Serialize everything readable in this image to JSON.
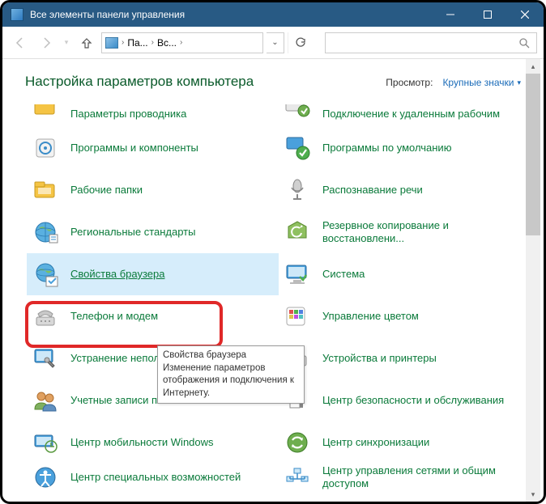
{
  "window": {
    "title": "Все элементы панели управления"
  },
  "toolbar": {
    "breadcrumb": [
      "Па...",
      "Вс..."
    ]
  },
  "header": {
    "title": "Настройка параметров компьютера",
    "view_label": "Просмотр:",
    "view_value": "Крупные значки"
  },
  "tooltip": {
    "title": "Свойства браузера",
    "body": "Изменение параметров отображения и подключения к Интернету."
  },
  "items": [
    {
      "label": "Параметры проводника",
      "icon": "folder-options",
      "cut": true
    },
    {
      "label": "Подключение к удаленным рабочим",
      "icon": "remote-app",
      "cut": true
    },
    {
      "label": "Программы и компоненты",
      "icon": "programs"
    },
    {
      "label": "Программы по умолчанию",
      "icon": "default-programs"
    },
    {
      "label": "Рабочие папки",
      "icon": "work-folders"
    },
    {
      "label": "Распознавание речи",
      "icon": "speech"
    },
    {
      "label": "Региональные стандарты",
      "icon": "region"
    },
    {
      "label": "Резервное копирование и восстановлени...",
      "icon": "backup"
    },
    {
      "label": "Свойства браузера",
      "icon": "internet-options",
      "highlighted": true
    },
    {
      "label": "Система",
      "icon": "system"
    },
    {
      "label": "Телефон и модем",
      "icon": "phone-modem"
    },
    {
      "label": "Управление цветом",
      "icon": "color-mgmt"
    },
    {
      "label": "Устранение неполадок",
      "icon": "troubleshoot"
    },
    {
      "label": "Устройства и принтеры",
      "icon": "devices-printers"
    },
    {
      "label": "Учетные записи пользователей",
      "icon": "user-accounts"
    },
    {
      "label": "Центр безопасности и обслуживания",
      "icon": "security-center"
    },
    {
      "label": "Центр мобильности Windows",
      "icon": "mobility-center"
    },
    {
      "label": "Центр синхронизации",
      "icon": "sync-center"
    },
    {
      "label": "Центр специальных возможностей",
      "icon": "ease-of-access",
      "cutbottom": true
    },
    {
      "label": "Центр управления сетями и общим доступом",
      "icon": "network-center",
      "cutbottom": true
    }
  ]
}
